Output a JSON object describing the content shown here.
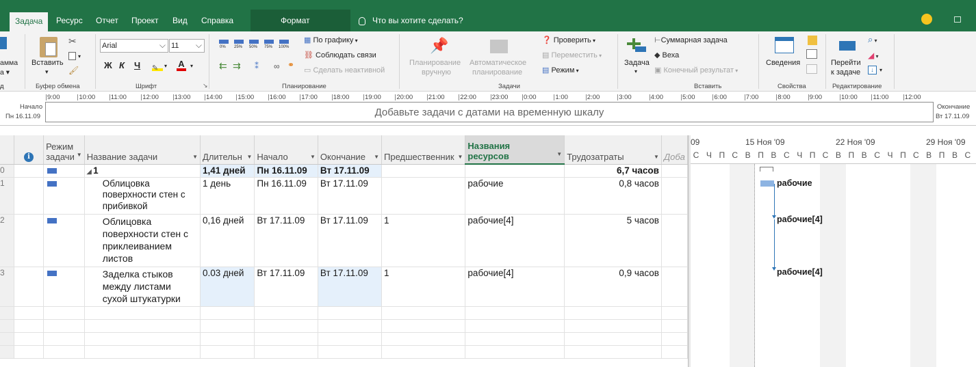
{
  "tabs": [
    "Задача",
    "Ресурс",
    "Отчет",
    "Проект",
    "Вид",
    "Справка",
    "Формат"
  ],
  "tell_me": "Что вы хотите сделать?",
  "ribbon": {
    "left_cut": [
      "амма",
      "а ▾",
      "д"
    ],
    "paste": "Вставить",
    "clipboard_label": "Буфер обмена",
    "font_name": "Arial",
    "font_size": "11",
    "bold": "Ж",
    "italic": "К",
    "underline": "Ч",
    "font_color": "А",
    "font_label": "Шрифт",
    "pct_labels": [
      "0%",
      "25%",
      "50%",
      "75%",
      "100%"
    ],
    "schedule_on_track": "По графику",
    "respect_links": "Соблюдать связи",
    "inactivate": "Сделать неактивной",
    "planning_label": "Планирование",
    "manual_l1": "Планирование",
    "manual_l2": "вручную",
    "auto_l1": "Автоматическое",
    "auto_l2": "планирование",
    "inspect": "Проверить",
    "move": "Переместить",
    "mode": "Режим",
    "tasks_label": "Задачи",
    "task_btn": "Задача",
    "summary_task": "Суммарная задача",
    "milestone": "Веха",
    "deliverable": "Конечный результат",
    "insert_label": "Вставить",
    "info": "Сведения",
    "properties_label": "Свойства",
    "goto_l1": "Перейти",
    "goto_l2": "к задаче",
    "editing_label": "Редактирование"
  },
  "timeline": {
    "start_label": "Начало",
    "start_date": "Пн 16.11.09",
    "end_label": "Окончание",
    "end_date": "Вт 17.11.09",
    "placeholder": "Добавьте задачи с датами на временную шкалу",
    "hours": [
      "9:00",
      "10:00",
      "11:00",
      "12:00",
      "13:00",
      "14:00",
      "15:00",
      "16:00",
      "17:00",
      "18:00",
      "19:00",
      "20:00",
      "21:00",
      "22:00",
      "23:00",
      "0:00",
      "1:00",
      "2:00",
      "3:00",
      "4:00",
      "5:00",
      "6:00",
      "7:00",
      "8:00",
      "9:00",
      "10:00",
      "11:00",
      "12:00"
    ]
  },
  "columns": {
    "info": "i",
    "mode": "Режим задачи",
    "name": "Название задачи",
    "duration": "Длительн",
    "start": "Начало",
    "finish": "Окончание",
    "predecessors": "Предшественник",
    "resources": "Названия ресурсов",
    "work": "Трудозатраты",
    "add": "Доба"
  },
  "rows": [
    {
      "num": "0",
      "name": "1",
      "duration": "1,41 дней",
      "start": "Пн 16.11.09",
      "finish": "Вт 17.11.09",
      "predecessors": "",
      "resources": "",
      "work": "6,7 часов",
      "summary": true
    },
    {
      "num": "1",
      "name": "Облицовка поверхности стен с прибивкой",
      "duration": "1 день",
      "start": "Пн 16.11.09",
      "finish": "Вт 17.11.09",
      "predecessors": "",
      "resources": "рабочие",
      "work": "0,8 часов"
    },
    {
      "num": "2",
      "name": "Облицовка поверхности стен с приклеиванием листов",
      "duration": "0,16 дней",
      "start": "Вт 17.11.09",
      "finish": "Вт 17.11.09",
      "predecessors": "1",
      "resources": "рабочие[4]",
      "work": "5 часов"
    },
    {
      "num": "3",
      "name": "Заделка стыков между листами сухой штукатурки",
      "duration": "0.03 дней",
      "start": "Вт 17.11.09",
      "finish": "Вт 17.11.09",
      "predecessors": "1",
      "resources": "рабочие[4]",
      "work": "0,9 часов"
    }
  ],
  "gantt": {
    "weeks": [
      "09",
      "15 Ноя '09",
      "22 Ноя '09",
      "29 Ноя '09"
    ],
    "days": [
      "С",
      "Ч",
      "П",
      "С",
      "В",
      "П",
      "В",
      "С",
      "Ч",
      "П",
      "С",
      "В",
      "П",
      "В",
      "С",
      "Ч",
      "П",
      "С",
      "В",
      "П",
      "В",
      "С"
    ],
    "bar_labels": [
      "рабочие",
      "рабочие[4]",
      "рабочие[4]"
    ]
  },
  "colors": {
    "accent": "#217346",
    "highlight": "#e5f0fb",
    "bar": "#8db4e2"
  }
}
